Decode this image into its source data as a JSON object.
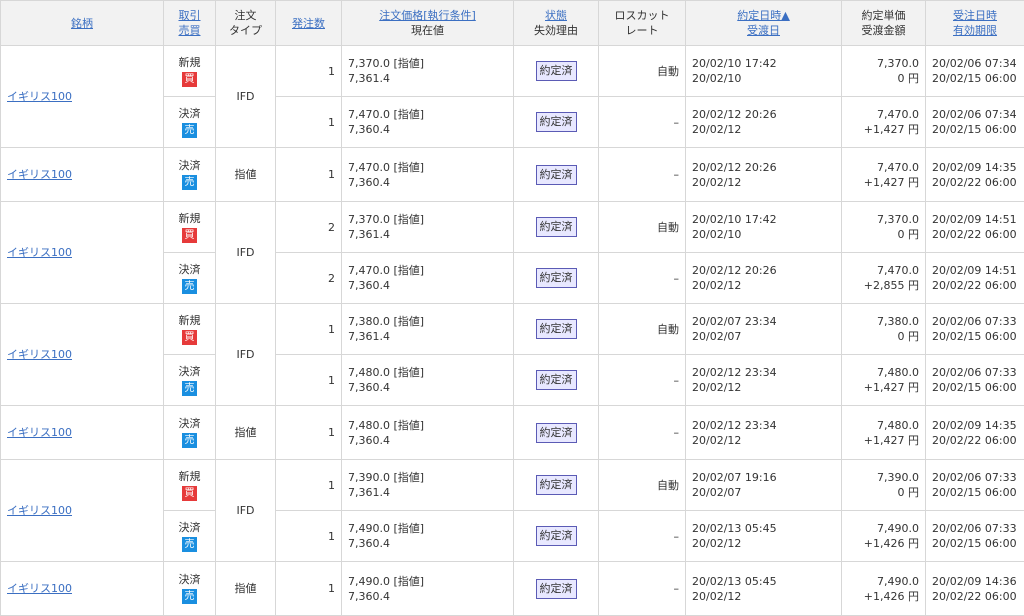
{
  "headers": {
    "symbol": "銘柄",
    "side_a": "取引",
    "side_b": "売買",
    "type_a": "注文",
    "type_b": "タイプ",
    "qty": "発注数",
    "price_a": "注文価格[執行条件]",
    "price_b": "現在値",
    "status_a": "状態",
    "status_b": "失効理由",
    "losscut_a": "ロスカット",
    "losscut_b": "レート",
    "exec_a": "約定日時▲",
    "exec_b": "受渡日",
    "unit_a": "約定単価",
    "unit_b": "受渡金額",
    "order_a": "受注日時",
    "order_b": "有効期限"
  },
  "orders": [
    {
      "symbol": "イギリス100",
      "type": "IFD",
      "rows": [
        {
          "trade": "新規",
          "side": "買",
          "qty": "1",
          "price": "7,370.0 [指値]",
          "current": "7,361.4",
          "status": "約定済",
          "losscut": "自動",
          "exec_dt": "20/02/10 17:42",
          "deliv": "20/02/10",
          "unit": "7,370.0",
          "amount": "0 円",
          "order_dt": "20/02/06 07:34",
          "expiry": "20/02/15 06:00"
        },
        {
          "trade": "決済",
          "side": "売",
          "qty": "1",
          "price": "7,470.0 [指値]",
          "current": "7,360.4",
          "status": "約定済",
          "losscut": "–",
          "exec_dt": "20/02/12 20:26",
          "deliv": "20/02/12",
          "unit": "7,470.0",
          "amount": "+1,427 円",
          "order_dt": "20/02/06 07:34",
          "expiry": "20/02/15 06:00"
        }
      ]
    },
    {
      "symbol": "イギリス100",
      "type": "指値",
      "rows": [
        {
          "trade": "決済",
          "side": "売",
          "qty": "1",
          "price": "7,470.0 [指値]",
          "current": "7,360.4",
          "status": "約定済",
          "losscut": "–",
          "exec_dt": "20/02/12 20:26",
          "deliv": "20/02/12",
          "unit": "7,470.0",
          "amount": "+1,427 円",
          "order_dt": "20/02/09 14:35",
          "expiry": "20/02/22 06:00"
        }
      ]
    },
    {
      "symbol": "イギリス100",
      "type": "IFD",
      "rows": [
        {
          "trade": "新規",
          "side": "買",
          "qty": "2",
          "price": "7,370.0 [指値]",
          "current": "7,361.4",
          "status": "約定済",
          "losscut": "自動",
          "exec_dt": "20/02/10 17:42",
          "deliv": "20/02/10",
          "unit": "7,370.0",
          "amount": "0 円",
          "order_dt": "20/02/09 14:51",
          "expiry": "20/02/22 06:00"
        },
        {
          "trade": "決済",
          "side": "売",
          "qty": "2",
          "price": "7,470.0 [指値]",
          "current": "7,360.4",
          "status": "約定済",
          "losscut": "–",
          "exec_dt": "20/02/12 20:26",
          "deliv": "20/02/12",
          "unit": "7,470.0",
          "amount": "+2,855 円",
          "order_dt": "20/02/09 14:51",
          "expiry": "20/02/22 06:00"
        }
      ]
    },
    {
      "symbol": "イギリス100",
      "type": "IFD",
      "rows": [
        {
          "trade": "新規",
          "side": "買",
          "qty": "1",
          "price": "7,380.0 [指値]",
          "current": "7,361.4",
          "status": "約定済",
          "losscut": "自動",
          "exec_dt": "20/02/07 23:34",
          "deliv": "20/02/07",
          "unit": "7,380.0",
          "amount": "0 円",
          "order_dt": "20/02/06 07:33",
          "expiry": "20/02/15 06:00"
        },
        {
          "trade": "決済",
          "side": "売",
          "qty": "1",
          "price": "7,480.0 [指値]",
          "current": "7,360.4",
          "status": "約定済",
          "losscut": "–",
          "exec_dt": "20/02/12 23:34",
          "deliv": "20/02/12",
          "unit": "7,480.0",
          "amount": "+1,427 円",
          "order_dt": "20/02/06 07:33",
          "expiry": "20/02/15 06:00"
        }
      ]
    },
    {
      "symbol": "イギリス100",
      "type": "指値",
      "rows": [
        {
          "trade": "決済",
          "side": "売",
          "qty": "1",
          "price": "7,480.0 [指値]",
          "current": "7,360.4",
          "status": "約定済",
          "losscut": "–",
          "exec_dt": "20/02/12 23:34",
          "deliv": "20/02/12",
          "unit": "7,480.0",
          "amount": "+1,427 円",
          "order_dt": "20/02/09 14:35",
          "expiry": "20/02/22 06:00"
        }
      ]
    },
    {
      "symbol": "イギリス100",
      "type": "IFD",
      "rows": [
        {
          "trade": "新規",
          "side": "買",
          "qty": "1",
          "price": "7,390.0 [指値]",
          "current": "7,361.4",
          "status": "約定済",
          "losscut": "自動",
          "exec_dt": "20/02/07 19:16",
          "deliv": "20/02/07",
          "unit": "7,390.0",
          "amount": "0 円",
          "order_dt": "20/02/06 07:33",
          "expiry": "20/02/15 06:00"
        },
        {
          "trade": "決済",
          "side": "売",
          "qty": "1",
          "price": "7,490.0 [指値]",
          "current": "7,360.4",
          "status": "約定済",
          "losscut": "–",
          "exec_dt": "20/02/13 05:45",
          "deliv": "20/02/12",
          "unit": "7,490.0",
          "amount": "+1,426 円",
          "order_dt": "20/02/06 07:33",
          "expiry": "20/02/15 06:00"
        }
      ]
    },
    {
      "symbol": "イギリス100",
      "type": "指値",
      "rows": [
        {
          "trade": "決済",
          "side": "売",
          "qty": "1",
          "price": "7,490.0 [指値]",
          "current": "7,360.4",
          "status": "約定済",
          "losscut": "–",
          "exec_dt": "20/02/13 05:45",
          "deliv": "20/02/12",
          "unit": "7,490.0",
          "amount": "+1,426 円",
          "order_dt": "20/02/09 14:36",
          "expiry": "20/02/22 06:00"
        }
      ]
    }
  ]
}
